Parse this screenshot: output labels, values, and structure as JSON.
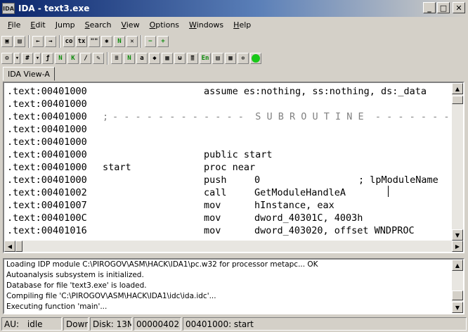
{
  "window": {
    "title": "IDA - text3.exe",
    "app_icon": "IDA"
  },
  "menu": [
    "File",
    "Edit",
    "Jump",
    "Search",
    "View",
    "Options",
    "Windows",
    "Help"
  ],
  "toolbar1": {
    "buttons": [
      {
        "name": "open-icon",
        "glyph": "▣"
      },
      {
        "name": "save-icon",
        "glyph": "▤"
      },
      {
        "name": "back-arrow-icon",
        "glyph": "←"
      },
      {
        "name": "forward-arrow-icon",
        "glyph": "→"
      },
      {
        "name": "code-icon",
        "glyph": "co"
      },
      {
        "name": "text-icon",
        "glyph": "tx"
      },
      {
        "name": "quote-icon",
        "glyph": "\"\""
      },
      {
        "name": "star-icon",
        "glyph": "✱"
      },
      {
        "name": "n-green-icon",
        "glyph": "N"
      },
      {
        "name": "cross-icon",
        "glyph": "✕"
      },
      {
        "name": "minus-green-icon",
        "glyph": "−"
      },
      {
        "name": "plus-green-icon",
        "glyph": "+"
      }
    ]
  },
  "toolbar2": {
    "buttons": [
      {
        "name": "options-icon",
        "glyph": "⚙"
      },
      {
        "name": "hash-icon",
        "glyph": "#"
      },
      {
        "name": "function-icon",
        "glyph": "ƒ"
      },
      {
        "name": "n-icon",
        "glyph": "N"
      },
      {
        "name": "k-icon",
        "glyph": "K"
      },
      {
        "name": "minus-slash-icon",
        "glyph": "/"
      },
      {
        "name": "pencil-icon",
        "glyph": "✎"
      },
      {
        "name": "document-icon",
        "glyph": "≡"
      },
      {
        "name": "n-doc-icon",
        "glyph": "N"
      },
      {
        "name": "names-icon",
        "glyph": "a"
      },
      {
        "name": "comment-icon",
        "glyph": "◆"
      },
      {
        "name": "struct-icon",
        "glyph": "▦"
      },
      {
        "name": "hex-icon",
        "glyph": "ω"
      },
      {
        "name": "calc-icon",
        "glyph": "≣"
      },
      {
        "name": "en-icon",
        "glyph": "En"
      },
      {
        "name": "list-icon",
        "glyph": "▤"
      },
      {
        "name": "grid-icon",
        "glyph": "▦"
      },
      {
        "name": "settings-icon",
        "glyph": "✲"
      },
      {
        "name": "run-icon",
        "glyph": ""
      }
    ]
  },
  "tab": {
    "label": "IDA View-A"
  },
  "listing": {
    "lines": [
      {
        "addr": ".text:00401000",
        "label": "",
        "mnem": "assume es:nothing, ss:nothing, ds:_data",
        "ops": "",
        "cmt": "",
        "kind": "assume"
      },
      {
        "addr": ".text:00401000",
        "label": "",
        "mnem": "",
        "ops": "",
        "cmt": "",
        "kind": "plain"
      },
      {
        "addr": ".text:00401000",
        "label": ";",
        "mnem": "- - - - - - - - - - - -  S U B R O U T I N E  - - - - - - - - - - - -",
        "ops": "",
        "cmt": "",
        "kind": "separator"
      },
      {
        "addr": ".text:00401000",
        "label": "",
        "mnem": "",
        "ops": "",
        "cmt": "",
        "kind": "plain"
      },
      {
        "addr": ".text:00401000",
        "label": "",
        "mnem": "",
        "ops": "",
        "cmt": "",
        "kind": "plain"
      },
      {
        "addr": ".text:00401000",
        "label": "",
        "mnem": "public start",
        "ops": "",
        "cmt": "",
        "kind": "plain"
      },
      {
        "addr": ".text:00401000",
        "label": "start",
        "mnem": "proc near",
        "ops": "",
        "cmt": "",
        "kind": "plain"
      },
      {
        "addr": ".text:00401000",
        "label": "",
        "mnem": "push",
        "ops": "0",
        "cmt": "; lpModuleName",
        "kind": "plain"
      },
      {
        "addr": ".text:00401002",
        "label": "",
        "mnem": "call",
        "ops": "GetModuleHandleA",
        "cmt": "",
        "kind": "plain"
      },
      {
        "addr": ".text:00401007",
        "label": "",
        "mnem": "mov",
        "ops": "hInstance, eax",
        "cmt": "",
        "kind": "plain"
      },
      {
        "addr": ".text:0040100C",
        "label": "",
        "mnem": "mov",
        "ops": "dword_40301C, 4003h",
        "cmt": "",
        "kind": "plain"
      },
      {
        "addr": ".text:00401016",
        "label": "",
        "mnem": "mov",
        "ops": "dword_403020, offset WNDPROC",
        "cmt": "",
        "kind": "plain"
      }
    ]
  },
  "output": {
    "lines": [
      "Loading IDP module C:\\PIROGOV\\ASM\\HACK\\IDA1\\pc.w32 for processor metapc... OK",
      "Autoanalysis subsystem is initialized.",
      "Database for file 'text3.exe' is loaded.",
      "Compiling file 'C:\\PIROGOV\\ASM\\HACK\\IDA1\\idc\\ida.idc'...",
      "Executing function 'main'..."
    ]
  },
  "status": {
    "au": "AU:",
    "au_state": "idle",
    "down": "Down",
    "disk": "Disk: 13M",
    "offset": "00000402",
    "location": "00401000: start"
  }
}
